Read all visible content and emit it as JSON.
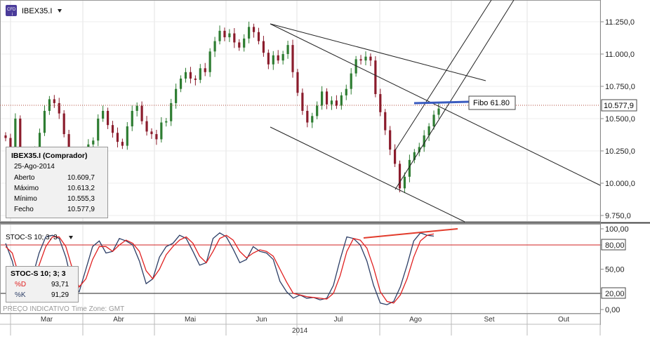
{
  "symbol": "IBEX35.I",
  "symbol_icon": "chart-badge-icon",
  "symbol_dropdown_icon": "triangle-down-icon",
  "colors": {
    "bull": "#2e7d32",
    "bear": "#8b1c2c",
    "price_line": "#b04a3a",
    "k_line": "#2c3e66",
    "d_line": "#e02020",
    "fibo_line": "#3a5bbf",
    "divergence_line": "#e23c2c"
  },
  "chart_data": [
    {
      "type": "candlestick",
      "y_ticks": [
        "11.250,0",
        "11.000,0",
        "10.750,0",
        "10.500,0",
        "10.250,0",
        "10.000,0",
        "9.750,0"
      ],
      "ylim": [
        9700,
        11420
      ],
      "current_price_label": "10.577,9",
      "annotation": "Fibo 61.80",
      "x_month_labels": [
        "Mar",
        "Abr",
        "Mai",
        "Jun",
        "Jul",
        "Ago",
        "Set",
        "Out"
      ],
      "year_label": "2014",
      "close_estimates": [
        10350,
        10280,
        10500,
        10220,
        10080,
        10110,
        10260,
        10390,
        10560,
        10650,
        10620,
        10540,
        10380,
        10230,
        10000,
        9960,
        10150,
        10300,
        10330,
        10500,
        10560,
        10450,
        10390,
        10320,
        10290,
        10440,
        10560,
        10600,
        10480,
        10400,
        10380,
        10340,
        10470,
        10480,
        10620,
        10730,
        10810,
        10860,
        10810,
        10800,
        10890,
        10860,
        11020,
        11100,
        11180,
        11130,
        11160,
        11090,
        11050,
        11120,
        11210,
        11170,
        11100,
        11010,
        10920,
        10990,
        10950,
        11000,
        11070,
        10860,
        10700,
        10560,
        10470,
        10520,
        10600,
        10710,
        10610,
        10640,
        10600,
        10680,
        10730,
        10850,
        10960,
        10950,
        10980,
        10950,
        10690,
        10550,
        10410,
        10260,
        10150,
        9960,
        10050,
        10180,
        10240,
        10280,
        10370,
        10440,
        10530,
        10578
      ],
      "ohlc_panel": {
        "title": "IBEX35.I (Comprador)",
        "date": "25-Ago-2014",
        "rows": [
          {
            "label": "Aberto",
            "value": "10.609,7"
          },
          {
            "label": "Máximo",
            "value": "10.613,2"
          },
          {
            "label": "Mínimo",
            "value": "10.555,3"
          },
          {
            "label": "Fecho",
            "value": "10.577,9"
          }
        ]
      }
    },
    {
      "type": "line",
      "indicator_label": "STOC-S 10; 3; 3",
      "indicator_dropdown_icon": "triangle-down-icon",
      "y_ticks": [
        "100,00",
        "80,00",
        "50,00",
        "20,00",
        "0,00"
      ],
      "highlighted_levels": [
        "80,00",
        "20,00"
      ],
      "ylim": [
        0,
        100
      ],
      "series": [
        {
          "name": "%D",
          "value_label": "93,71"
        },
        {
          "name": "%K",
          "value_label": "91,29"
        }
      ],
      "k_values": [
        82,
        60,
        25,
        18,
        40,
        70,
        90,
        92,
        88,
        65,
        30,
        22,
        50,
        78,
        85,
        70,
        72,
        88,
        85,
        80,
        60,
        32,
        38,
        65,
        78,
        82,
        92,
        88,
        72,
        55,
        58,
        88,
        95,
        90,
        75,
        58,
        62,
        78,
        72,
        70,
        62,
        35,
        22,
        14,
        18,
        14,
        15,
        12,
        14,
        30,
        62,
        90,
        88,
        80,
        60,
        30,
        8,
        6,
        10,
        28,
        55,
        85,
        95,
        92,
        91
      ],
      "d_values": [
        78,
        70,
        42,
        24,
        30,
        55,
        78,
        90,
        90,
        78,
        50,
        28,
        38,
        62,
        78,
        78,
        72,
        80,
        86,
        82,
        72,
        48,
        38,
        50,
        68,
        78,
        86,
        90,
        82,
        66,
        58,
        72,
        88,
        92,
        86,
        72,
        64,
        70,
        74,
        72,
        66,
        50,
        34,
        20,
        18,
        16,
        15,
        14,
        13,
        20,
        42,
        72,
        88,
        86,
        76,
        52,
        22,
        10,
        8,
        18,
        38,
        65,
        85,
        92,
        93.7
      ],
      "divergence_note": ""
    }
  ],
  "footer": {
    "price_type_label": "PREÇO INDICATIVO",
    "timezone_label": "Time Zone: GMT"
  }
}
